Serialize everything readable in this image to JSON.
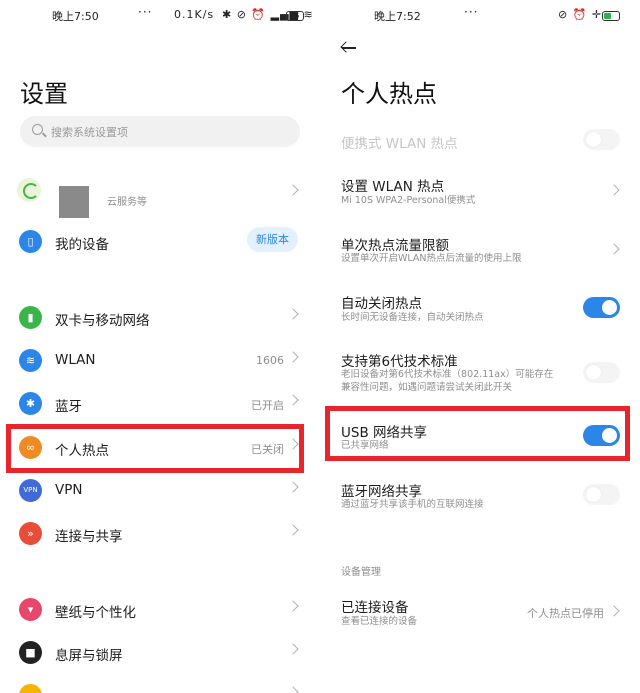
{
  "left": {
    "status": {
      "time": "晚上7:50",
      "speed": "0.1K/s",
      "battery": "55",
      "dots": "···"
    },
    "title": "设置",
    "search_placeholder": "搜索系统设置项",
    "account": {
      "subtitle": "云服务等"
    },
    "device": {
      "label": "我的设备",
      "badge": "新版本",
      "color": "#2b86e8"
    },
    "items": [
      {
        "label": "双卡与移动网络",
        "value": "",
        "icon": "sim-card-icon",
        "color": "#3ab54a"
      },
      {
        "label": "WLAN",
        "value": "1606",
        "icon": "wifi-icon",
        "color": "#2b86e8"
      },
      {
        "label": "蓝牙",
        "value": "已开启",
        "icon": "bluetooth-icon",
        "color": "#2b86e8"
      },
      {
        "label": "个人热点",
        "value": "已关闭",
        "icon": "hotspot-icon",
        "color": "#f08a24"
      },
      {
        "label": "VPN",
        "value": "",
        "icon": "vpn-icon",
        "color": "#3f6ad8"
      },
      {
        "label": "连接与共享",
        "value": "",
        "icon": "connection-icon",
        "color": "#e94d3a"
      },
      {
        "label": "壁纸与个性化",
        "value": "",
        "icon": "wallpaper-icon",
        "color": "#e9466b"
      },
      {
        "label": "息屏与锁屏",
        "value": "",
        "icon": "lock-icon",
        "color": "#222222"
      }
    ],
    "highlight_color": "#e8252c"
  },
  "right": {
    "status": {
      "time": "晚上7:52",
      "dots": "···"
    },
    "title": "个人热点",
    "portable": {
      "title": "便携式 WLAN 热点",
      "enabled": false
    },
    "wlan_setup": {
      "title": "设置 WLAN 热点",
      "subtitle": "Mi 10S WPA2-Personal便携式"
    },
    "data_limit": {
      "title": "单次热点流量限额",
      "subtitle": "设置单次开启WLAN热点后流量的使用上限"
    },
    "auto_off": {
      "title": "自动关闭热点",
      "subtitle": "长时间无设备连接，自动关闭热点",
      "enabled": true
    },
    "wifi6": {
      "title": "支持第6代技术标准",
      "subtitle": "老旧设备对第6代技术标准（802.11ax）可能存在兼容性问题，如遇问题请尝试关闭此开关",
      "enabled": false
    },
    "usb_share": {
      "title": "USB 网络共享",
      "subtitle": "已共享网络",
      "enabled": true
    },
    "bt_share": {
      "title": "蓝牙网络共享",
      "subtitle": "通过蓝牙共享该手机的互联网连接",
      "enabled": false
    },
    "section_header": "设备管理",
    "connected": {
      "title": "已连接设备",
      "subtitle": "查看已连接的设备",
      "value": "个人热点已停用"
    },
    "accent": "#2b86e8"
  }
}
